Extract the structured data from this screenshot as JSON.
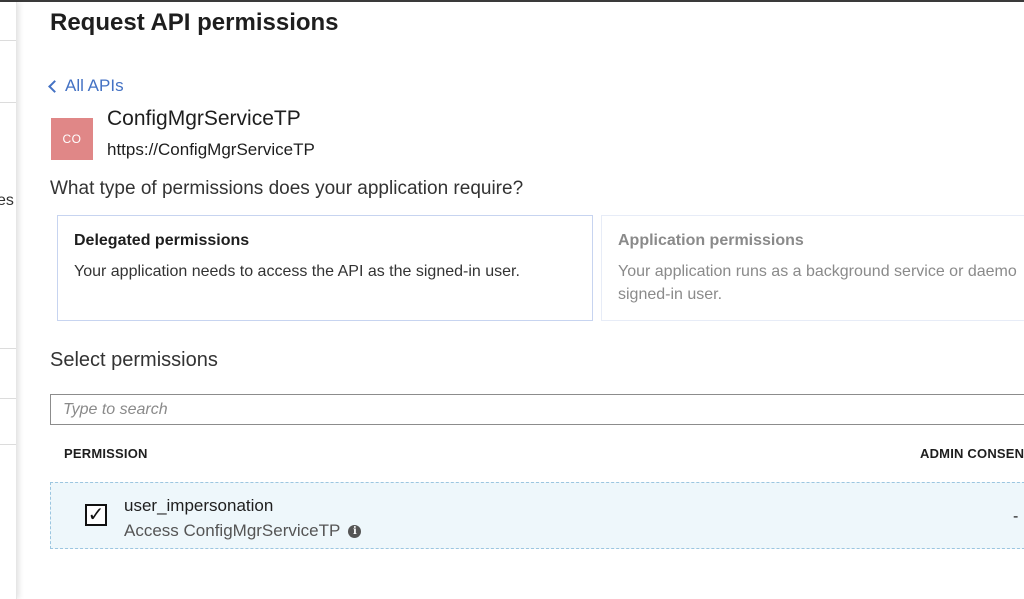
{
  "panel": {
    "title": "Request API permissions"
  },
  "nav": {
    "back_label": "All APIs"
  },
  "api": {
    "logo_text": "CO",
    "name": "ConfigMgrServiceTP",
    "url": "https://ConfigMgrServiceTP"
  },
  "question": "What type of permissions does your application require?",
  "permission_types": [
    {
      "title": "Delegated permissions",
      "description": "Your application needs to access the API as the signed-in user.",
      "selected": true
    },
    {
      "title": "Application permissions",
      "description": "Your application runs as a background service or daemo signed-in user.",
      "selected": false
    }
  ],
  "select_section": {
    "title": "Select permissions",
    "search_placeholder": "Type to search"
  },
  "table": {
    "columns": [
      "PERMISSION",
      "ADMIN CONSENT"
    ],
    "rows": [
      {
        "name": "user_impersonation",
        "description": "Access ConfigMgrServiceTP",
        "checked": true,
        "admin_consent": "-"
      }
    ]
  },
  "left_panel_fragment": "es",
  "colors": {
    "link": "#4472c4",
    "logo_bg": "#e08787",
    "row_highlight": "#eef7fb"
  }
}
